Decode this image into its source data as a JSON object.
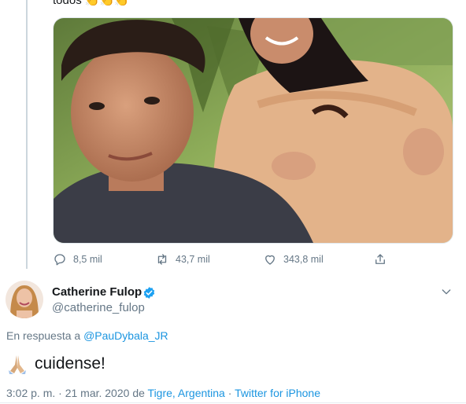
{
  "prev_tweet": {
    "cut_text": "todos",
    "emoji_text": "👏👏👏",
    "replies": "8,5 mil",
    "retweets": "43,7 mil",
    "likes": "343,8 mil",
    "icons": [
      "reply-icon",
      "retweet-icon",
      "like-icon",
      "share-icon"
    ]
  },
  "tweet": {
    "name": "Catherine Fulop",
    "handle": "@catherine_fulop",
    "reply_prefix": "En respuesta a",
    "reply_to": "@PauDybala_JR",
    "emoji": "🙏🏼",
    "text": "cuidense!",
    "time_date": "3:02 p. m. · 21 mar. 2020",
    "de": "de",
    "location": "Tigre, Argentina",
    "separator": "·",
    "source": "Twitter for iPhone",
    "icons": [
      "verified-badge-icon",
      "chevron-down-icon",
      "folded-hands-icon"
    ]
  },
  "colors": {
    "link": "#1b95e0",
    "secondary": "#657786",
    "verified": "#1da1f2",
    "thread_line": "#ccd6dd"
  }
}
